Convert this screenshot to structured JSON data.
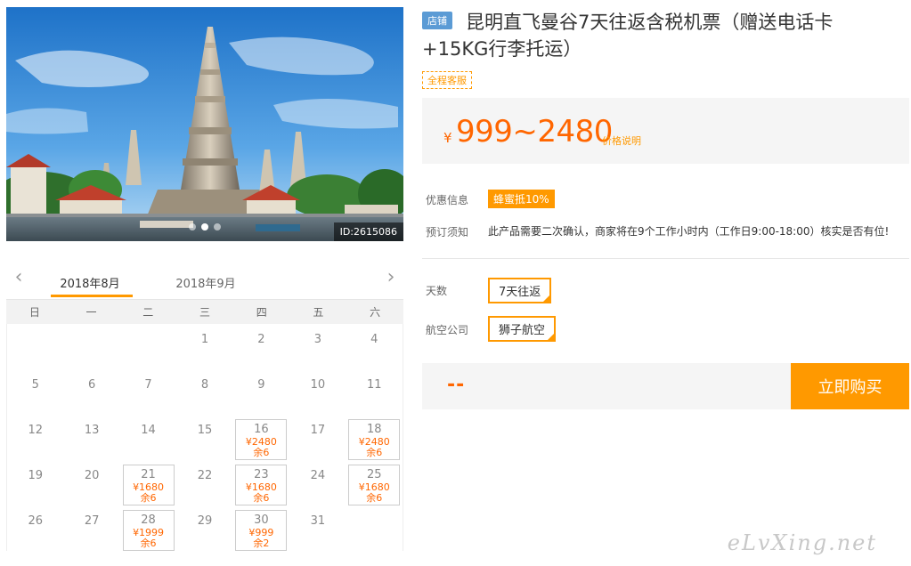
{
  "hero": {
    "id_label": "ID:2615086",
    "slides": 3,
    "active_slide": 1
  },
  "calendar": {
    "months": [
      "2018年8月",
      "2018年9月"
    ],
    "weekdays": [
      "日",
      "一",
      "二",
      "三",
      "四",
      "五",
      "六"
    ],
    "leading_blanks": 3,
    "days": [
      {
        "d": "1"
      },
      {
        "d": "2"
      },
      {
        "d": "3"
      },
      {
        "d": "4"
      },
      {
        "d": "5"
      },
      {
        "d": "6"
      },
      {
        "d": "7"
      },
      {
        "d": "8"
      },
      {
        "d": "9"
      },
      {
        "d": "10"
      },
      {
        "d": "11"
      },
      {
        "d": "12"
      },
      {
        "d": "13"
      },
      {
        "d": "14"
      },
      {
        "d": "15"
      },
      {
        "d": "16",
        "price": "¥2480",
        "left": "余6"
      },
      {
        "d": "17"
      },
      {
        "d": "18",
        "price": "¥2480",
        "left": "余6"
      },
      {
        "d": "19"
      },
      {
        "d": "20"
      },
      {
        "d": "21",
        "price": "¥1680",
        "left": "余6"
      },
      {
        "d": "22"
      },
      {
        "d": "23",
        "price": "¥1680",
        "left": "余6"
      },
      {
        "d": "24"
      },
      {
        "d": "25",
        "price": "¥1680",
        "left": "余6"
      },
      {
        "d": "26"
      },
      {
        "d": "27"
      },
      {
        "d": "28",
        "price": "¥1999",
        "left": "余6"
      },
      {
        "d": "29"
      },
      {
        "d": "30",
        "price": "¥999",
        "left": "余2"
      },
      {
        "d": "31"
      }
    ]
  },
  "product": {
    "shop_tag": "店铺",
    "title_line1": "昆明直飞曼谷7天往返含税机票（赠送电话卡",
    "title_line2": "+15KG行李托运）",
    "service_tag": "全程客服",
    "currency": "¥",
    "price": "999~2480",
    "price_note": "价格说明"
  },
  "info": {
    "promo_label": "优惠信息",
    "promo_badge": "蜂蜜抵10%",
    "notice_label": "预订须知",
    "notice_text": "此产品需要二次确认，商家将在9个工作小时内（工作日9:00-18:00）核实是否有位!"
  },
  "options": {
    "days_label": "天数",
    "days_value": "7天往返",
    "airline_label": "航空公司",
    "airline_value": "狮子航空"
  },
  "buy": {
    "price_placeholder": "--",
    "button": "立即购买"
  },
  "watermark": "eLvXing.net"
}
